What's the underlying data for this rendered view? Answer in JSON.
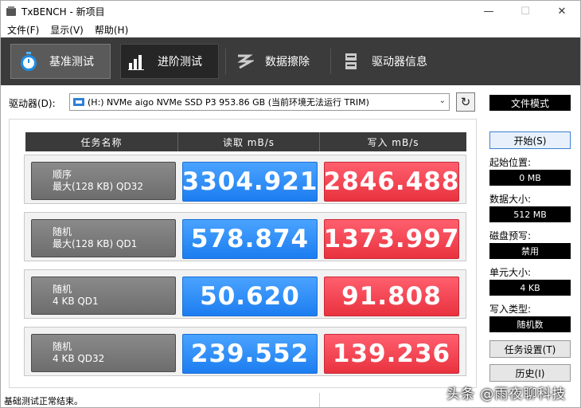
{
  "window": {
    "title": "TxBENCH - 新项目"
  },
  "menu": [
    "文件(F)",
    "显示(V)",
    "帮助(H)"
  ],
  "toolbar": {
    "tabs": [
      {
        "label": "基准测试",
        "icon": "stopwatch-icon"
      },
      {
        "label": "进阶测试",
        "icon": "bar-chart-icon"
      },
      {
        "label": "数据擦除",
        "icon": "erase-icon"
      },
      {
        "label": "驱动器信息",
        "icon": "drive-info-icon"
      }
    ]
  },
  "drive": {
    "label": "驱动器(D):",
    "selected": "(H:) NVMe aigo NVMe SSD P3  953.86 GB (当前环境无法运行 TRIM)",
    "mode": "文件模式"
  },
  "table": {
    "headers": [
      "任务名称",
      "读取 mB/s",
      "写入 mB/s"
    ],
    "rows": [
      {
        "name1": "顺序",
        "name2": "最大(128 KB) QD32",
        "read": "3304.921",
        "write": "2846.488"
      },
      {
        "name1": "随机",
        "name2": "最大(128 KB) QD1",
        "read": "578.874",
        "write": "1373.997"
      },
      {
        "name1": "随机",
        "name2": "4 KB QD1",
        "read": "50.620",
        "write": "91.808"
      },
      {
        "name1": "随机",
        "name2": "4 KB QD32",
        "read": "239.552",
        "write": "139.236"
      }
    ]
  },
  "side": {
    "start": "开始(S)",
    "start_pos_label": "起始位置:",
    "start_pos_value": "0 MB",
    "data_size_label": "数据大小:",
    "data_size_value": "512 MB",
    "precondition_label": "磁盘预写:",
    "precondition_value": "禁用",
    "unit_size_label": "单元大小:",
    "unit_size_value": "4 KB",
    "write_type_label": "写入类型:",
    "write_type_value": "随机数",
    "task_settings": "任务设置(T)",
    "history": "历史(I)"
  },
  "status": {
    "text": "基础测试正常结束。"
  },
  "watermark": "头条 @雨夜聊科技",
  "colors": {
    "read": "#1c7df0",
    "write": "#e9323f",
    "toolbar": "#3b3b3b"
  }
}
